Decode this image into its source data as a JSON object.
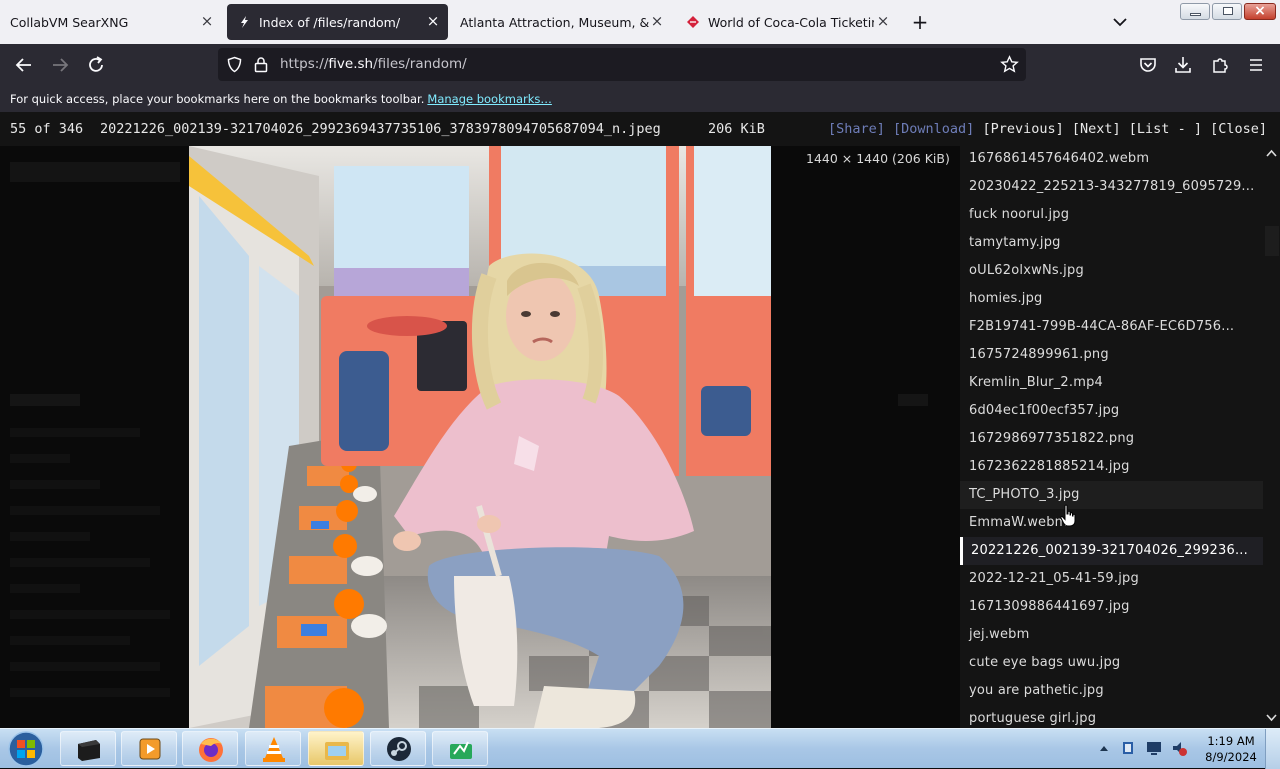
{
  "browser": {
    "tabs": [
      {
        "title": "CollabVM SearXNG",
        "active": false
      },
      {
        "title": "Index of /files/random/",
        "active": true
      },
      {
        "title": "Atlanta Attraction, Museum, & Venue",
        "active": false
      },
      {
        "title": "World of Coca-Cola Ticketing Sys",
        "active": false
      }
    ],
    "new_tab": "+",
    "url": {
      "prefix": "https://",
      "host": "five.sh",
      "path": "/files/random/"
    },
    "bookmarks_message": "For quick access, place your bookmarks here on the bookmarks toolbar.",
    "bookmarks_link": "Manage bookmarks…"
  },
  "gallery": {
    "position": "55 of 346",
    "filename": "20221226_002139-321704026_2992369437735106_3783978094705687094_n.jpeg",
    "filesize": "206 KiB",
    "share": "[Share]",
    "download": "[Download]",
    "previous": "[Previous]",
    "next": "[Next]",
    "list": "[List - ]",
    "close": "[Close]",
    "image_dimensions": "1440 × 1440 (206 KiB)"
  },
  "file_list": [
    "1676861457646402.webm",
    "20230422_225213-343277819_6095729...",
    "fuck noorul.jpg",
    "tamytamy.jpg",
    "oUL62olxwNs.jpg",
    "homies.jpg",
    "F2B19741-799B-44CA-86AF-EC6D756...",
    "1675724899961.png",
    "Kremlin_Blur_2.mp4",
    "6d04ec1f00ecf357.jpg",
    "1672986977351822.png",
    "1672362281885214.jpg",
    "TC_PHOTO_3.jpg",
    "EmmaW.webm",
    "20221226_002139-321704026_299236...",
    "2022-12-21_05-41-59.jpg",
    "1671309886441697.jpg",
    "jej.webm",
    "cute eye bags uwu.jpg",
    "you are pathetic.jpg",
    "portuguese girl.jpg"
  ],
  "file_list_current_index": 14,
  "file_list_hover_index": 12,
  "taskbar": {
    "apps": [
      "terminal-icon",
      "media-center-icon",
      "firefox-icon",
      "vlc-icon",
      "file-explorer-icon",
      "steam-icon",
      "network-tool-icon"
    ],
    "time": "1:19 AM",
    "date": "8/9/2024"
  },
  "colors": {
    "tab_strip": "#f0f0f4",
    "toolbar": "#2b2a33",
    "link": "#80ebff",
    "muted_action": "#6e7db8",
    "gallery_bg": "#141414"
  }
}
